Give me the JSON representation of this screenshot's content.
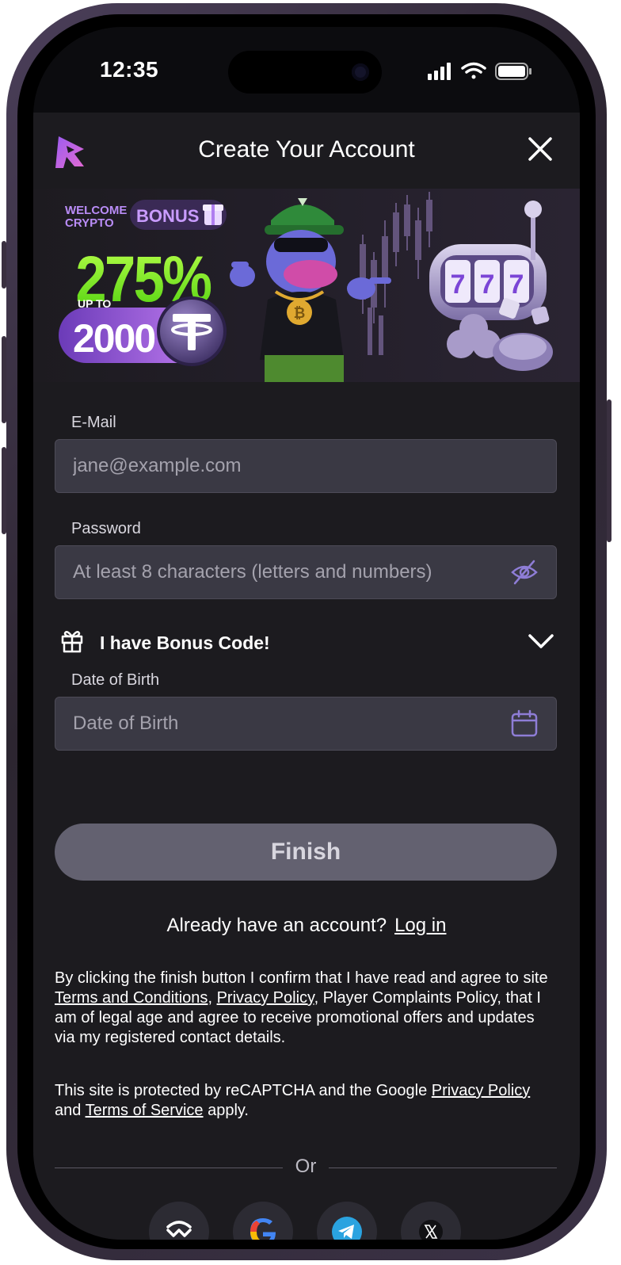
{
  "status_bar": {
    "time": "12:35"
  },
  "header": {
    "title": "Create Your Account"
  },
  "banner": {
    "welcome_line1": "WELCOME",
    "welcome_line2": "CRYPTO",
    "bonus_label": "BONUS",
    "percent": "275%",
    "up_to": "UP TO",
    "amount": "2000",
    "slot_digits": "777"
  },
  "form": {
    "email_label": "E-Mail",
    "email_placeholder": "jane@example.com",
    "password_label": "Password",
    "password_placeholder": "At least 8 characters (letters and numbers)",
    "bonus_code_text": "I have Bonus Code!",
    "dob_label": "Date of Birth",
    "dob_placeholder": "Date of Birth",
    "finish_label": "Finish"
  },
  "login_prompt": {
    "text": "Already have an account?",
    "link": "Log in"
  },
  "legal": {
    "p1_a": "By clicking the finish button I confirm that I have read and agree to site ",
    "terms_link": "Terms and Conditions",
    "comma": ", ",
    "privacy_link": "Privacy Policy",
    "p1_b": ", Player Complaints Policy, that I am of legal age and agree to receive promotional offers and updates via my registered contact details.",
    "p2_a": "This site is protected by reCAPTCHA and the Google ",
    "google_privacy_link": "Privacy Policy",
    "and": " and ",
    "google_terms_link": "Terms of Service",
    "p2_b": " apply."
  },
  "divider": {
    "or_text": "Or"
  },
  "social": [
    {
      "icon": "walletconnect-icon"
    },
    {
      "icon": "google-icon"
    },
    {
      "icon": "telegram-icon"
    },
    {
      "icon": "x-icon"
    }
  ],
  "colors": {
    "background": "#1c1b1f",
    "input_bg": "#3a3944",
    "accent_purple": "#9b7fe0",
    "green": "#7cf02a",
    "finish_bg": "#636170"
  }
}
